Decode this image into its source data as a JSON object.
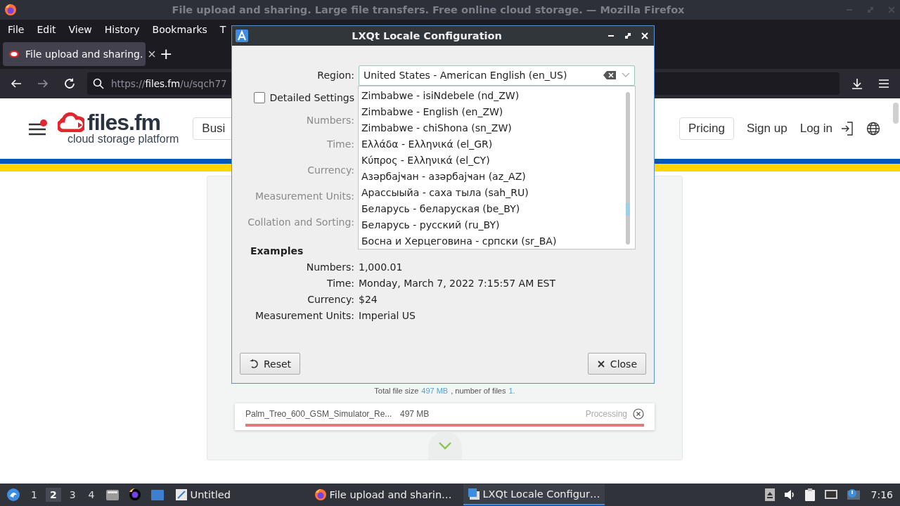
{
  "firefox": {
    "title": "File upload and sharing. Large file transfers. Free online cloud storage. — Mozilla Firefox",
    "menu": [
      "File",
      "Edit",
      "View",
      "History",
      "Bookmarks",
      "T"
    ],
    "tabs": [
      {
        "label": "File upload and sharing.",
        "selected": true
      }
    ],
    "new_tab": "+",
    "url": {
      "scheme": "https://",
      "host": "files.fm",
      "path": "/u/sqch77"
    }
  },
  "web_page": {
    "logo": {
      "name": "files.fm",
      "tagline": "cloud storage platform"
    },
    "nav_buttons": [
      "Busi",
      "Pricing"
    ],
    "nav_links": [
      "Sign up",
      "Log in"
    ],
    "summary": {
      "label": "Total file size",
      "size": "497 MB",
      "middle": ", number of files",
      "count": "1."
    },
    "file": {
      "name": "Palm_Treo_600_GSM_Simulator_Re...",
      "size": "497 MB",
      "status": "Processing",
      "level": 1
    }
  },
  "dialog": {
    "title": "LXQt Locale Configuration",
    "region": {
      "label": "Region:",
      "value": "United States - American English (en_US)"
    },
    "region_options": [
      "Zimbabwe - isiNdebele (nd_ZW)",
      "Zimbabwe - English (en_ZW)",
      "Zimbabwe - chiShona (sn_ZW)",
      "Ελλάδα - Ελληνικά (el_GR)",
      "Κύπρος - Ελληνικά (el_CY)",
      "Азәрбајҹан - азәрбајҹан (az_AZ)",
      "Арассыыйа - саха тыла (sah_RU)",
      "Беларусь - беларуская (be_BY)",
      "Беларусь - русский (ru_BY)",
      "Босна и Херцеговина - српски (sr_BA)"
    ],
    "detailed_settings": {
      "label": "Detailed Settings",
      "checked": false
    },
    "settings": [
      {
        "label": "Numbers:",
        "disabled": true
      },
      {
        "label": "Time:",
        "disabled": true
      },
      {
        "label": "Currency:",
        "disabled": true
      },
      {
        "label": "Measurement Units:",
        "disabled": true
      },
      {
        "label": "Collation and Sorting:",
        "disabled": true
      }
    ],
    "examples": {
      "heading": "Examples",
      "rows": [
        {
          "label": "Numbers:",
          "value": "1,000.01"
        },
        {
          "label": "Time:",
          "value": "Monday, March 7, 2022 7:15:57 AM EST"
        },
        {
          "label": "Currency:",
          "value": "$24"
        },
        {
          "label": "Measurement Units:",
          "value": "Imperial US"
        }
      ]
    },
    "buttons": [
      {
        "label": "Reset",
        "kind": "reset"
      },
      {
        "label": "Close",
        "kind": "close"
      }
    ]
  },
  "taskbar": {
    "desktops": [
      {
        "label": "1",
        "selected": false
      },
      {
        "label": "2",
        "selected": true
      },
      {
        "label": "3",
        "selected": false
      },
      {
        "label": "4",
        "selected": false
      }
    ],
    "tasks": [
      {
        "label": "Untitled",
        "kind": "editor",
        "selected": false
      },
      {
        "label": "File upload and sharin…",
        "kind": "firefox",
        "selected": false
      },
      {
        "label": "LXQt Locale Configur…",
        "kind": "settings",
        "selected": true
      }
    ],
    "clock": "7:16"
  }
}
